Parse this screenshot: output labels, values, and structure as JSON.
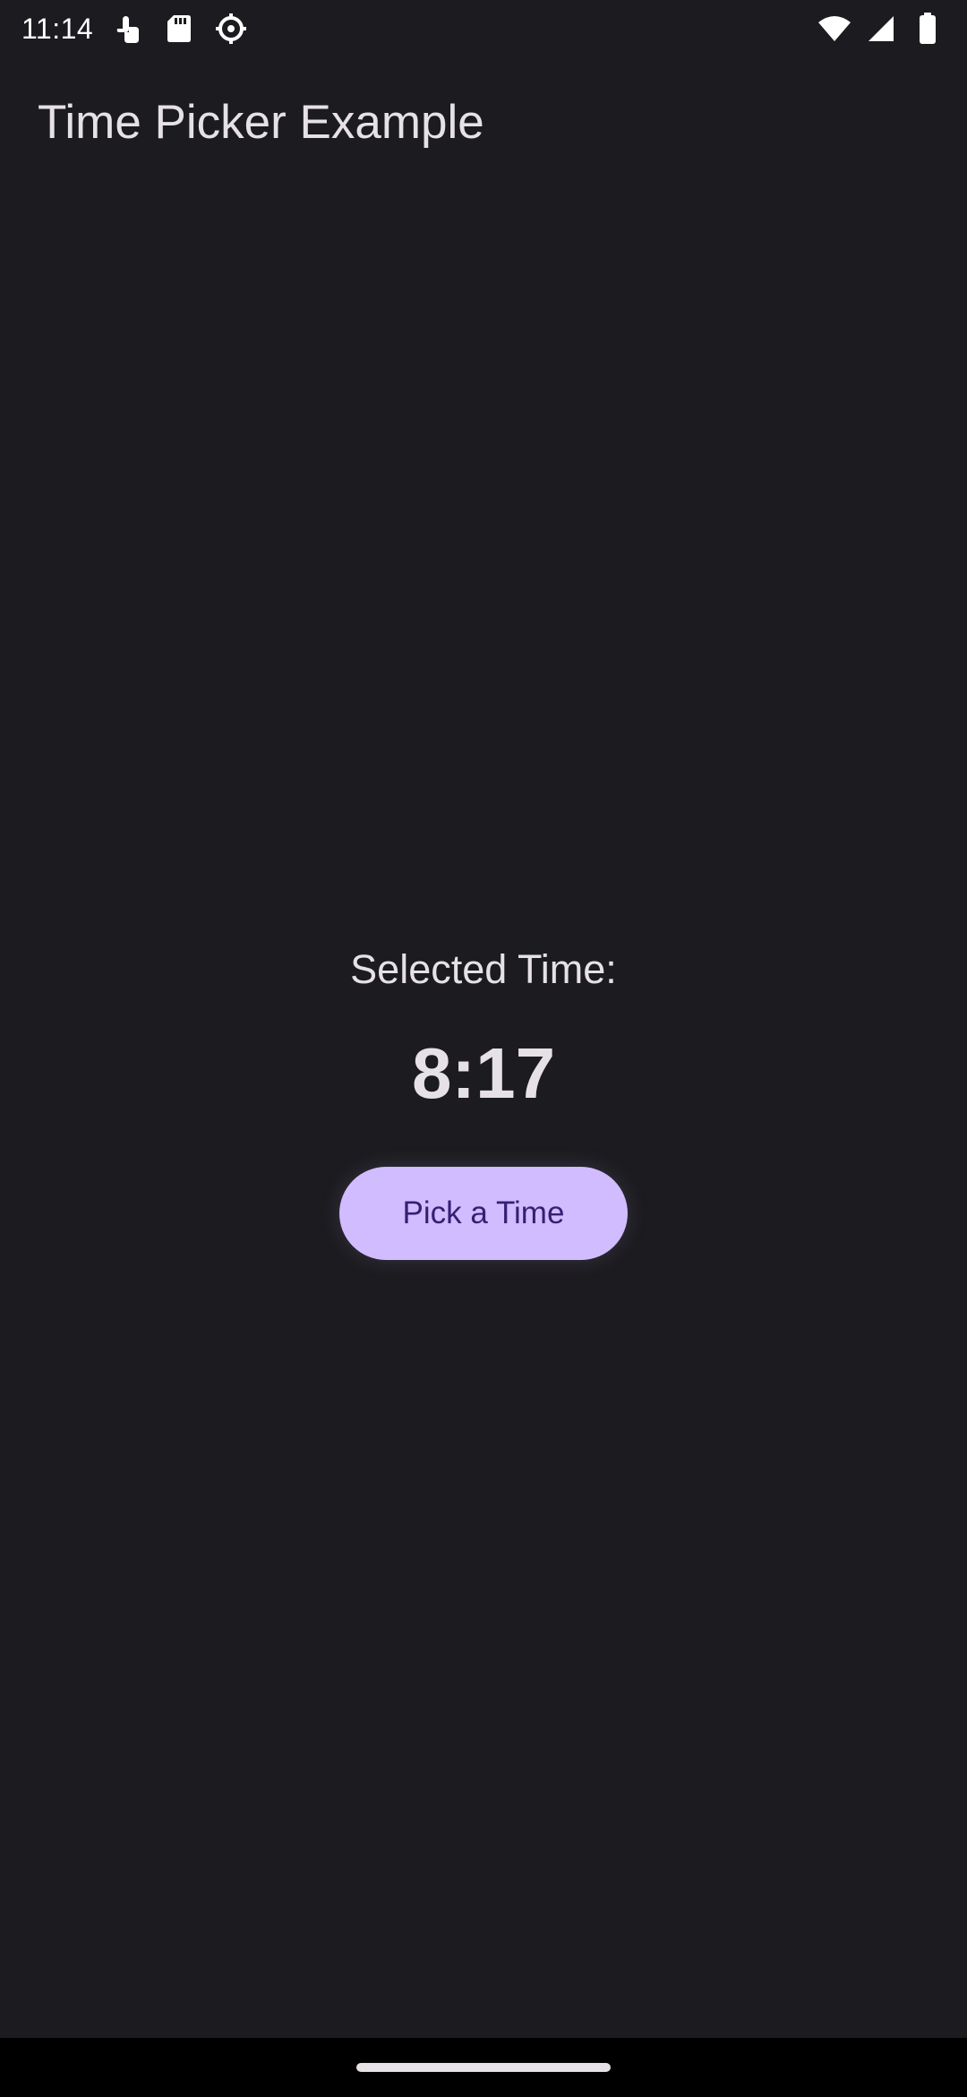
{
  "status_bar": {
    "time": "11:14",
    "left_icons": [
      "touch-gesture-icon",
      "sd-card-icon",
      "settings-sync-icon"
    ],
    "right_icons": [
      "wifi-icon",
      "signal-icon",
      "battery-icon"
    ]
  },
  "app_bar": {
    "title": "Time Picker Example"
  },
  "main": {
    "selected_label": "Selected Time:",
    "time_value": "8:17",
    "pick_button_label": "Pick a Time"
  },
  "colors": {
    "background": "#1c1b1f",
    "button_bg": "#d0bcff",
    "button_text": "#381e72",
    "text": "#e6e1e5"
  }
}
